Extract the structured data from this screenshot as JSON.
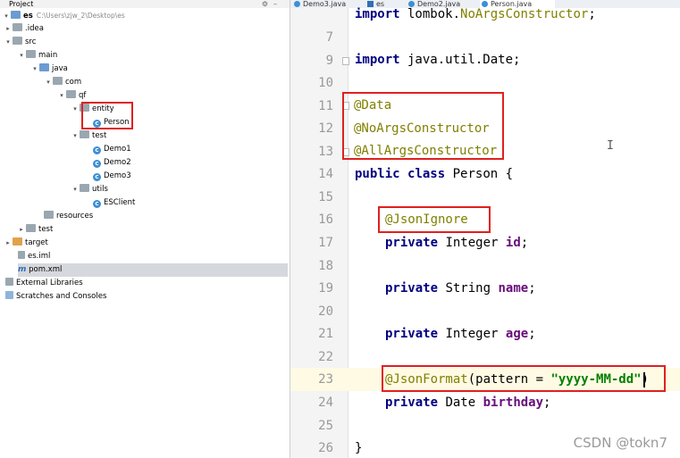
{
  "project_panel": {
    "header_title": "Project",
    "header_icons": [
      "gear-icon",
      "minus-icon"
    ],
    "tree": [
      {
        "label": "es",
        "path": "C:\\Users\\zjw_2\\Desktop\\es"
      },
      {
        "label": ".idea"
      },
      {
        "label": "src"
      },
      {
        "label": "main"
      },
      {
        "label": "java"
      },
      {
        "label": "com"
      },
      {
        "label": "qf"
      },
      {
        "label": "entity"
      },
      {
        "label": "Person"
      },
      {
        "label": "test"
      },
      {
        "label": "Demo1"
      },
      {
        "label": "Demo2"
      },
      {
        "label": "Demo3"
      },
      {
        "label": "utils"
      },
      {
        "label": "ESClient"
      },
      {
        "label": "resources"
      },
      {
        "label": "test"
      },
      {
        "label": "target"
      },
      {
        "label": "es.iml"
      },
      {
        "label": "pom.xml"
      },
      {
        "label": "External Libraries"
      },
      {
        "label": "Scratches and Consoles"
      }
    ]
  },
  "tabs": [
    {
      "label": "Demo3.java"
    },
    {
      "label": "es"
    },
    {
      "label": "Demo2.java"
    },
    {
      "label": "Person.java"
    }
  ],
  "editor": {
    "lines": [
      {
        "num": "",
        "text": "import lombok.NoArgsConstructor;"
      },
      {
        "num": "7",
        "text": ""
      },
      {
        "num": "9",
        "text": "import java.util.Date;"
      },
      {
        "num": "10",
        "text": ""
      },
      {
        "num": "11",
        "text": "@Data"
      },
      {
        "num": "12",
        "text": "@NoArgsConstructor"
      },
      {
        "num": "13",
        "text": "@AllArgsConstructor"
      },
      {
        "num": "14",
        "kw1": "public",
        "kw2": "class",
        "text": "Person {"
      },
      {
        "num": "15",
        "text": ""
      },
      {
        "num": "16",
        "text": "@JsonIgnore"
      },
      {
        "num": "17",
        "kw": "private",
        "type": "Integer",
        "field": "id",
        "end": ";"
      },
      {
        "num": "18",
        "text": ""
      },
      {
        "num": "19",
        "kw": "private",
        "type": "String",
        "field": "name",
        "end": ";"
      },
      {
        "num": "20",
        "text": ""
      },
      {
        "num": "21",
        "kw": "private",
        "type": "Integer",
        "field": "age",
        "end": ";"
      },
      {
        "num": "22",
        "text": ""
      },
      {
        "num": "23",
        "ann": "@JsonFormat",
        "mid": "(pattern = ",
        "str": "\"yyyy-MM-dd\"",
        "end": ")"
      },
      {
        "num": "24",
        "kw": "private",
        "type": "Date",
        "field": "birthday",
        "end": ";"
      },
      {
        "num": "25",
        "text": ""
      },
      {
        "num": "26",
        "text": "}"
      }
    ]
  },
  "watermark": "CSDN @tokn7",
  "colors": {
    "highlight_box": "#e02020",
    "annotation": "#808000",
    "keyword": "#000080",
    "string": "#008000",
    "field": "#660e7a"
  }
}
